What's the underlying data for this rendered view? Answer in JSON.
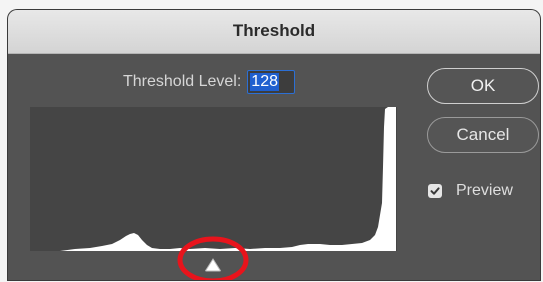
{
  "dialog": {
    "title": "Threshold",
    "level_label": "Threshold Level:",
    "level_value": "128"
  },
  "buttons": {
    "ok_label": "OK",
    "cancel_label": "Cancel"
  },
  "preview": {
    "label": "Preview",
    "checked": true
  },
  "colors": {
    "dialog_bg": "#535353",
    "titlebar_bg": "#dcdcdc",
    "histogram_bg": "#454545",
    "histogram_fill": "#ffffff",
    "selection": "#1f5fcf",
    "annotation_ring": "#e8141c"
  },
  "icons": {
    "slider_handle": "triangle-slider-handle-icon",
    "checkbox": "checkmark-icon"
  }
}
